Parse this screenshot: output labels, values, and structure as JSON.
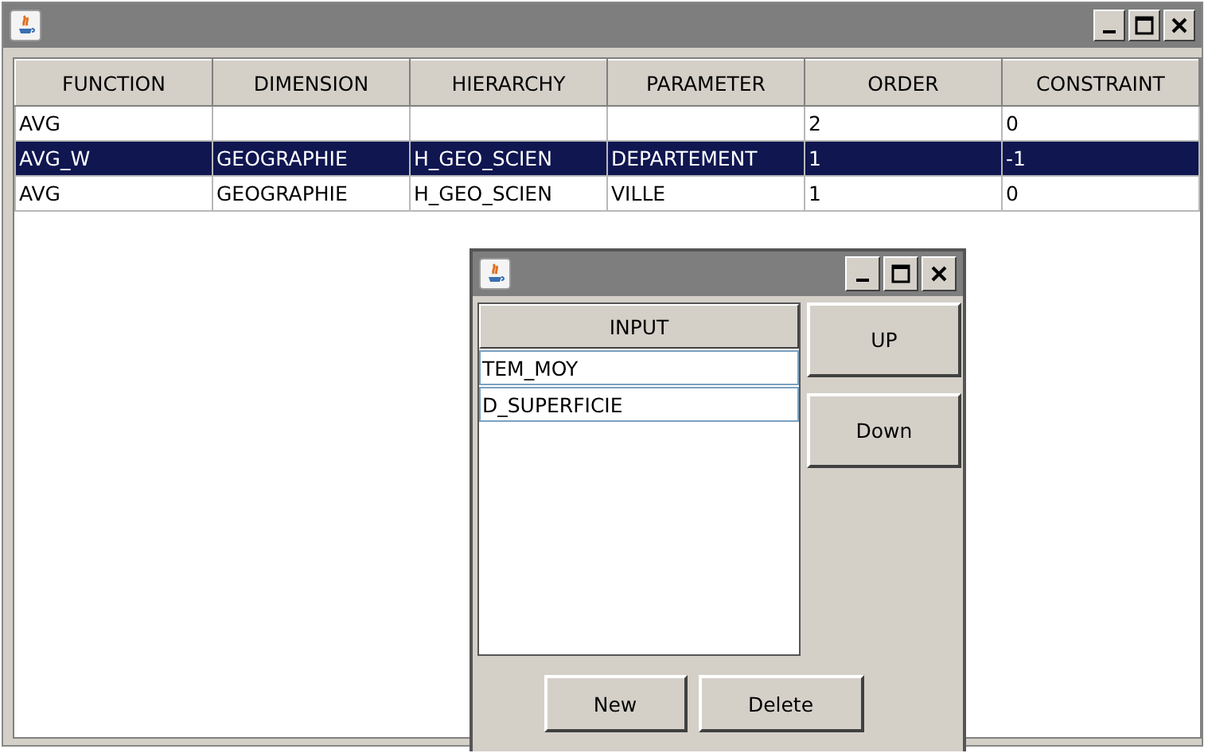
{
  "main_window": {
    "table": {
      "columns": [
        "FUNCTION",
        "DIMENSION",
        "HIERARCHY",
        "PARAMETER",
        "ORDER",
        "CONSTRAINT"
      ],
      "rows": [
        {
          "cells": [
            "AVG",
            null,
            null,
            null,
            "2",
            "0"
          ],
          "selected": false
        },
        {
          "cells": [
            "AVG_W",
            "GEOGRAPHIE",
            "H_GEO_SCIEN",
            "DEPARTEMENT",
            "1",
            "-1"
          ],
          "selected": true
        },
        {
          "cells": [
            "AVG",
            "GEOGRAPHIE",
            "H_GEO_SCIEN",
            "VILLE",
            "1",
            "0"
          ],
          "selected": false
        }
      ]
    }
  },
  "dialog": {
    "list": {
      "header": "INPUT",
      "items": [
        "TEM_MOY",
        "D_SUPERFICIE"
      ]
    },
    "side_buttons": [
      "UP",
      "Down"
    ],
    "bottom_buttons": [
      "New",
      "Delete"
    ]
  }
}
